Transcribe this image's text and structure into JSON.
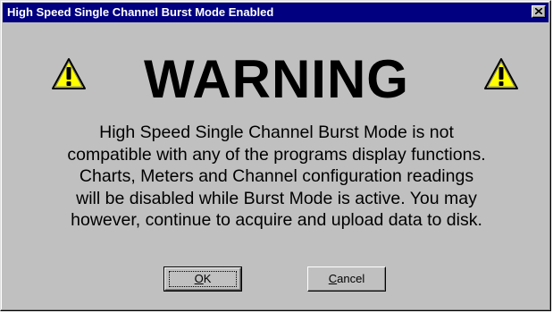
{
  "window": {
    "title": "High Speed Single Channel Burst Mode Enabled",
    "close_glyph": "✕"
  },
  "dialog": {
    "heading": "WARNING",
    "icon_left": "warning-triangle-icon",
    "icon_right": "warning-triangle-icon",
    "message_lines": [
      "High Speed Single Channel Burst Mode is not",
      "compatible with any of the programs display functions.",
      "Charts, Meters and Channel configuration readings",
      "will be disabled while Burst Mode is active.  You may",
      "however, continue to acquire and upload data to disk."
    ]
  },
  "buttons": {
    "ok": {
      "mnemonic": "O",
      "rest": "K"
    },
    "cancel": {
      "mnemonic": "C",
      "rest": "ancel"
    }
  },
  "colors": {
    "titlebar": "#000080",
    "face": "#c0c0c0",
    "warning_fill": "#ffff00"
  }
}
